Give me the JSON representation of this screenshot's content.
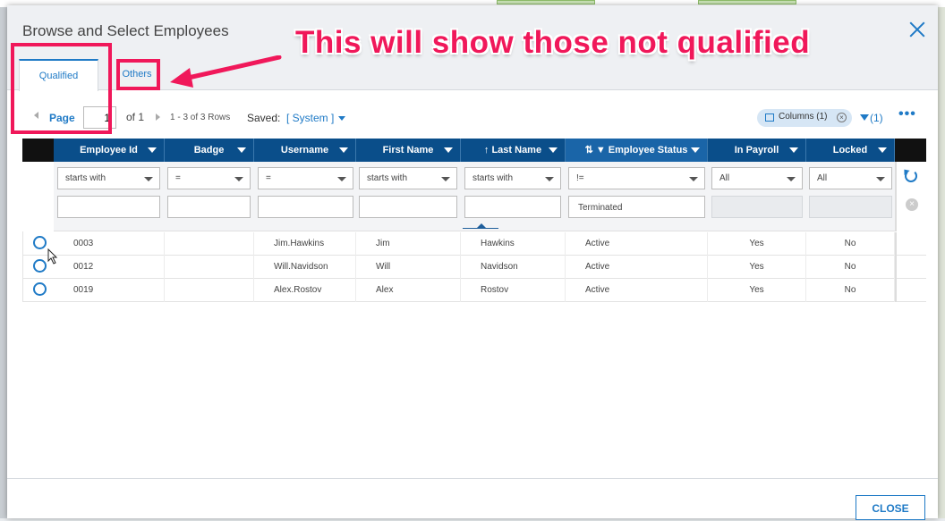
{
  "dialog": {
    "title": "Browse and Select Employees",
    "close_label": "CLOSE"
  },
  "tabs": [
    {
      "label": "Qualified",
      "active": true
    },
    {
      "label": "Others",
      "active": false
    }
  ],
  "annotation": {
    "text": "This will show those not qualified",
    "color": "#f0185a"
  },
  "pager": {
    "page_label": "Page",
    "page_value": "1",
    "of_label": "of 1",
    "rows_label": "1 - 3 of 3 Rows",
    "saved_label": "Saved:",
    "saved_value": "[ System ]"
  },
  "toolbar": {
    "columns_label": "Columns (1)",
    "filter_count": "(1)",
    "more": "•••"
  },
  "columns": [
    {
      "label": "Employee Id",
      "operator": "starts with",
      "value": ""
    },
    {
      "label": "Badge",
      "operator": "=",
      "value": ""
    },
    {
      "label": "Username",
      "operator": "=",
      "value": ""
    },
    {
      "label": "First Name",
      "operator": "starts with",
      "value": ""
    },
    {
      "label": "↑ Last Name",
      "operator": "starts with",
      "value": ""
    },
    {
      "label": "⇅ ▼ Employee Status",
      "operator": "!=",
      "value": "Terminated"
    },
    {
      "label": "In Payroll",
      "operator": "All",
      "value": ""
    },
    {
      "label": "Locked",
      "operator": "All",
      "value": ""
    }
  ],
  "rows": [
    [
      "0003",
      "",
      "Jim.Hawkins",
      "Jim",
      "Hawkins",
      "Active",
      "Yes",
      "No"
    ],
    [
      "0012",
      "",
      "Will.Navidson",
      "Will",
      "Navidson",
      "Active",
      "Yes",
      "No"
    ],
    [
      "0019",
      "",
      "Alex.Rostov",
      "Alex",
      "Rostov",
      "Active",
      "Yes",
      "No"
    ]
  ],
  "colors": {
    "accent": "#1f7ac6",
    "header_bg": "#0a4e8a",
    "annotation": "#f0185a"
  }
}
